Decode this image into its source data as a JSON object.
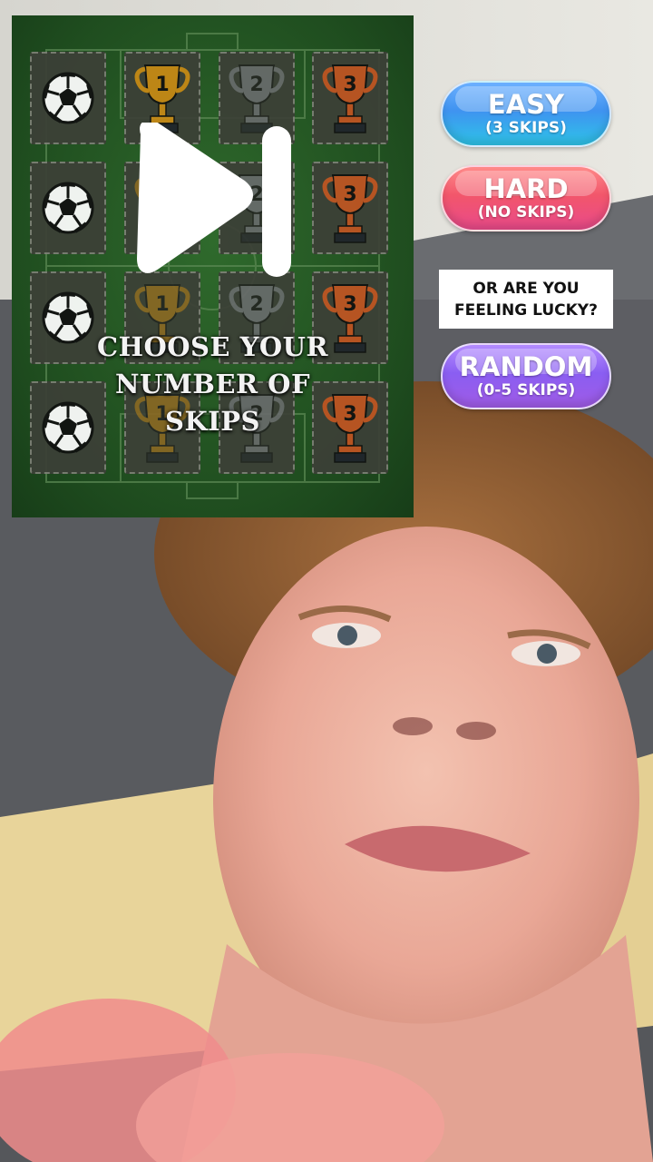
{
  "board": {
    "title_lines": [
      "CHOOSE YOUR",
      "NUMBER OF",
      "SKIPS"
    ],
    "icons": [
      "play-skip-icon",
      "soccer-ball-icon",
      "trophy-icon"
    ],
    "rows": [
      [
        "ball",
        "1",
        "2",
        "3"
      ],
      [
        "ball",
        "1",
        "2",
        "3"
      ],
      [
        "ball",
        "1",
        "2",
        "3"
      ],
      [
        "ball",
        "1",
        "2",
        "3"
      ]
    ],
    "trophy_colors": {
      "1": "#c98a16",
      "2": "#8c8f96",
      "3": "#c25523"
    }
  },
  "options": {
    "easy": {
      "label": "EASY",
      "sub": "(3 SKIPS)"
    },
    "hard": {
      "label": "HARD",
      "sub": "(NO SKIPS)"
    },
    "lucky_prompt": [
      "OR ARE YOU",
      "FEELING LUCKY?"
    ],
    "random": {
      "label": "RANDOM",
      "sub": "(0-5 SKIPS)"
    }
  },
  "colors": {
    "easy": "#3f93f0",
    "hard": "#f2566b",
    "random": "#8a5ef2",
    "pitch": "#245a23"
  }
}
